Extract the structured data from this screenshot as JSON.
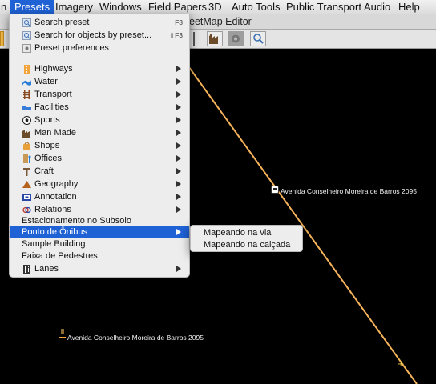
{
  "menubar": {
    "items": [
      "n",
      "Presets",
      "Imagery",
      "Windows",
      "Field Papers",
      "3D",
      "Auto Tools",
      "Public Transport",
      "Audio",
      "Help"
    ]
  },
  "window": {
    "title": "eetMap Editor"
  },
  "presets_menu": {
    "search_preset": {
      "label": "Search preset",
      "shortcut": "F3"
    },
    "search_objects": {
      "label": "Search for objects by preset...",
      "shortcut": "⇧F3"
    },
    "preferences": {
      "label": "Preset preferences"
    },
    "groups": [
      {
        "label": "Highways",
        "icon": "highway-icon",
        "color": "#f2a33a"
      },
      {
        "label": "Water",
        "icon": "water-icon",
        "color": "#2b7fd6"
      },
      {
        "label": "Transport",
        "icon": "rail-icon",
        "color": "#8a4b22"
      },
      {
        "label": "Facilities",
        "icon": "bed-icon",
        "color": "#3a7dd9"
      },
      {
        "label": "Sports",
        "icon": "soccer-ball-icon",
        "color": "#222222"
      },
      {
        "label": "Man Made",
        "icon": "factory-icon",
        "color": "#6b4b2a"
      },
      {
        "label": "Shops",
        "icon": "shop-icon",
        "color": "#e8a13a"
      },
      {
        "label": "Offices",
        "icon": "office-icon",
        "color": "#c89a55"
      },
      {
        "label": "Craft",
        "icon": "craft-icon",
        "color": "#7a5a3a"
      },
      {
        "label": "Geography",
        "icon": "mountain-icon",
        "color": "#b5621e"
      },
      {
        "label": "Annotation",
        "icon": "annotation-icon",
        "color": "#2848a8"
      },
      {
        "label": "Relations",
        "icon": "relation-icon",
        "color": "#c0392b"
      }
    ],
    "estacionamento": "Estacionamento no Subsolo",
    "ponto_de_onibus": "Ponto de Ônibus",
    "sample_building": "Sample Building",
    "faixa_de_pedestres": "Faixa de Pedestres",
    "lanes": "Lanes"
  },
  "submenu": {
    "items": [
      "Mapeando na via",
      "Mapeando na calçada"
    ]
  },
  "map": {
    "label_bus_stop": "Avenida Conselheiro Moreira de Barros 2095",
    "label_node": "Avenida Conselheiro Moreira de Barros 2095",
    "road_color": "#f7b45a"
  }
}
